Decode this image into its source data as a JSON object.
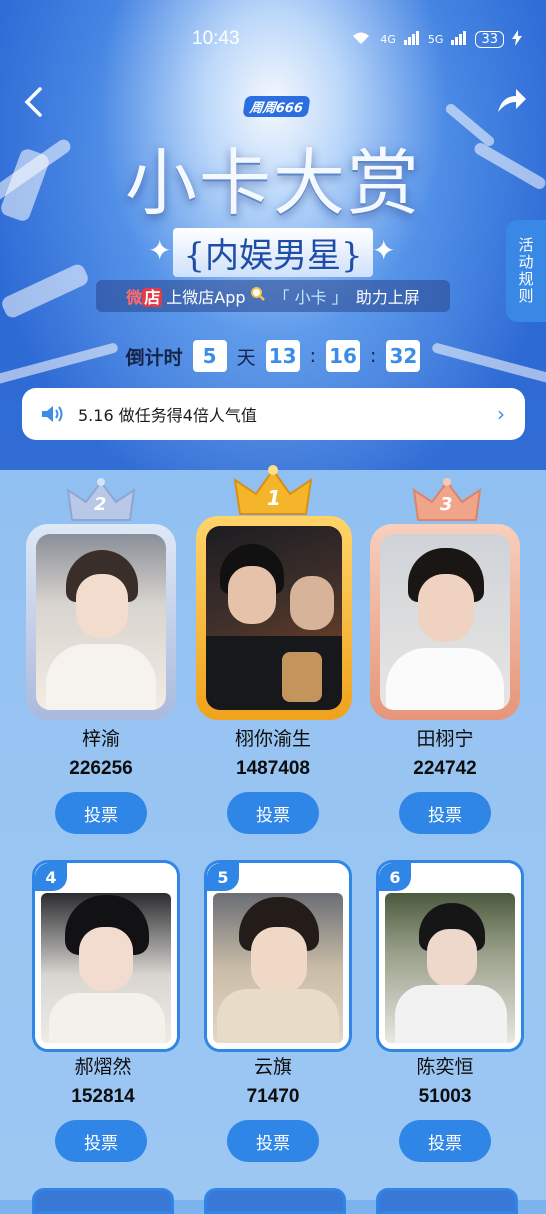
{
  "status_bar": {
    "time": "10:43",
    "network1": "6",
    "network2": "4G",
    "network3": "5G",
    "battery": "33"
  },
  "header": {
    "brand_tag": "周周666",
    "title": "小卡大赏",
    "subtitle": "{内娱男星}",
    "banner": {
      "logo_a": "微",
      "logo_b": "店",
      "text_before": "上微店App",
      "keyword": "「 小卡 」",
      "text_after": "助力上屏"
    },
    "rules_label": "活动规则"
  },
  "countdown": {
    "label": "倒计时",
    "days": "5",
    "day_unit": "天",
    "hours": "13",
    "sep": ":",
    "minutes": "16",
    "seconds": "32"
  },
  "notice": {
    "text": "5.16 做任务得4倍人气值"
  },
  "podium": [
    {
      "rank": "2",
      "name": "梓渝",
      "votes": "226256",
      "button": "投票"
    },
    {
      "rank": "1",
      "name": "栩你渝生",
      "votes": "1487408",
      "button": "投票"
    },
    {
      "rank": "3",
      "name": "田栩宁",
      "votes": "224742",
      "button": "投票"
    }
  ],
  "grid": [
    {
      "rank": "4",
      "name": "郝熠然",
      "votes": "152814",
      "button": "投票"
    },
    {
      "rank": "5",
      "name": "云旗",
      "votes": "71470",
      "button": "投票"
    },
    {
      "rank": "6",
      "name": "陈奕恒",
      "votes": "51003",
      "button": "投票"
    }
  ],
  "colors": {
    "accent": "#2f86e6",
    "gold": "#f5b52a",
    "silver": "#b9c8e6",
    "bronze": "#f0a489"
  }
}
